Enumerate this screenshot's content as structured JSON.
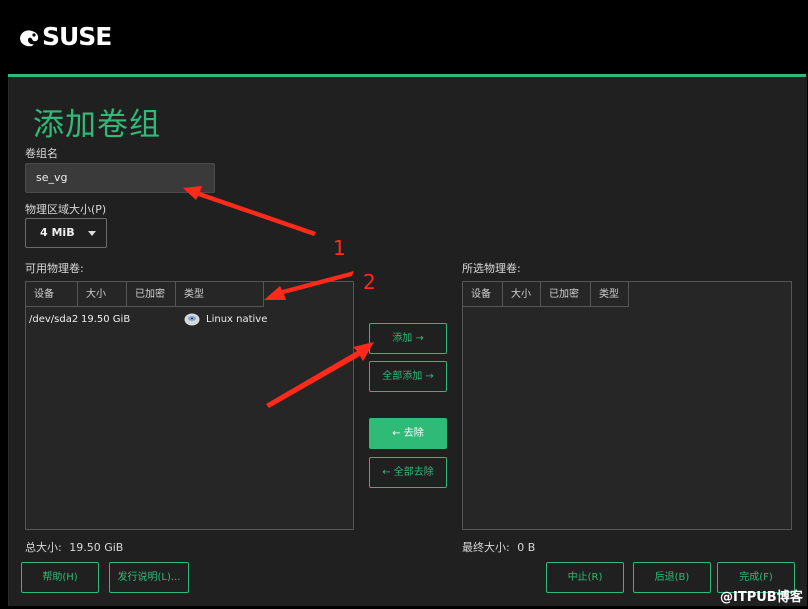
{
  "app": {
    "logo_text": "SUSE"
  },
  "page": {
    "title": "添加卷组"
  },
  "vg_name": {
    "label": "卷组名",
    "value": "se_vg"
  },
  "pe_size": {
    "label": "物理区域大小(P)",
    "selected": "4 MiB"
  },
  "available": {
    "label": "可用物理卷:",
    "columns": [
      "设备",
      "大小",
      "已加密",
      "类型"
    ],
    "rows": [
      {
        "device": "/dev/sda2",
        "size": "19.50 GiB",
        "encrypted": "",
        "type": "Linux native",
        "type_icon": "disk-icon"
      }
    ],
    "total_label": "总大小:",
    "total_value": "19.50 GiB"
  },
  "selected": {
    "label": "所选物理卷:",
    "columns": [
      "设备",
      "大小",
      "已加密",
      "类型"
    ],
    "rows": [],
    "total_label": "最终大小:",
    "total_value": "0 B"
  },
  "actions": {
    "add": "添加 →",
    "add_all": "全部添加 →",
    "remove": "← 去除",
    "remove_all": "← 全部去除"
  },
  "footer": {
    "help": "帮助(H)",
    "release_notes": "发行说明(L)...",
    "abort": "中止(R)",
    "back": "后退(B)",
    "finish": "完成(F)"
  },
  "annotations": {
    "marker_1": "1",
    "marker_2": "2",
    "color": "#ff2a1a"
  },
  "watermark": "@ITPUB博客",
  "colors": {
    "accent": "#30ba78",
    "background": "#202020",
    "topbar": "#000000"
  }
}
